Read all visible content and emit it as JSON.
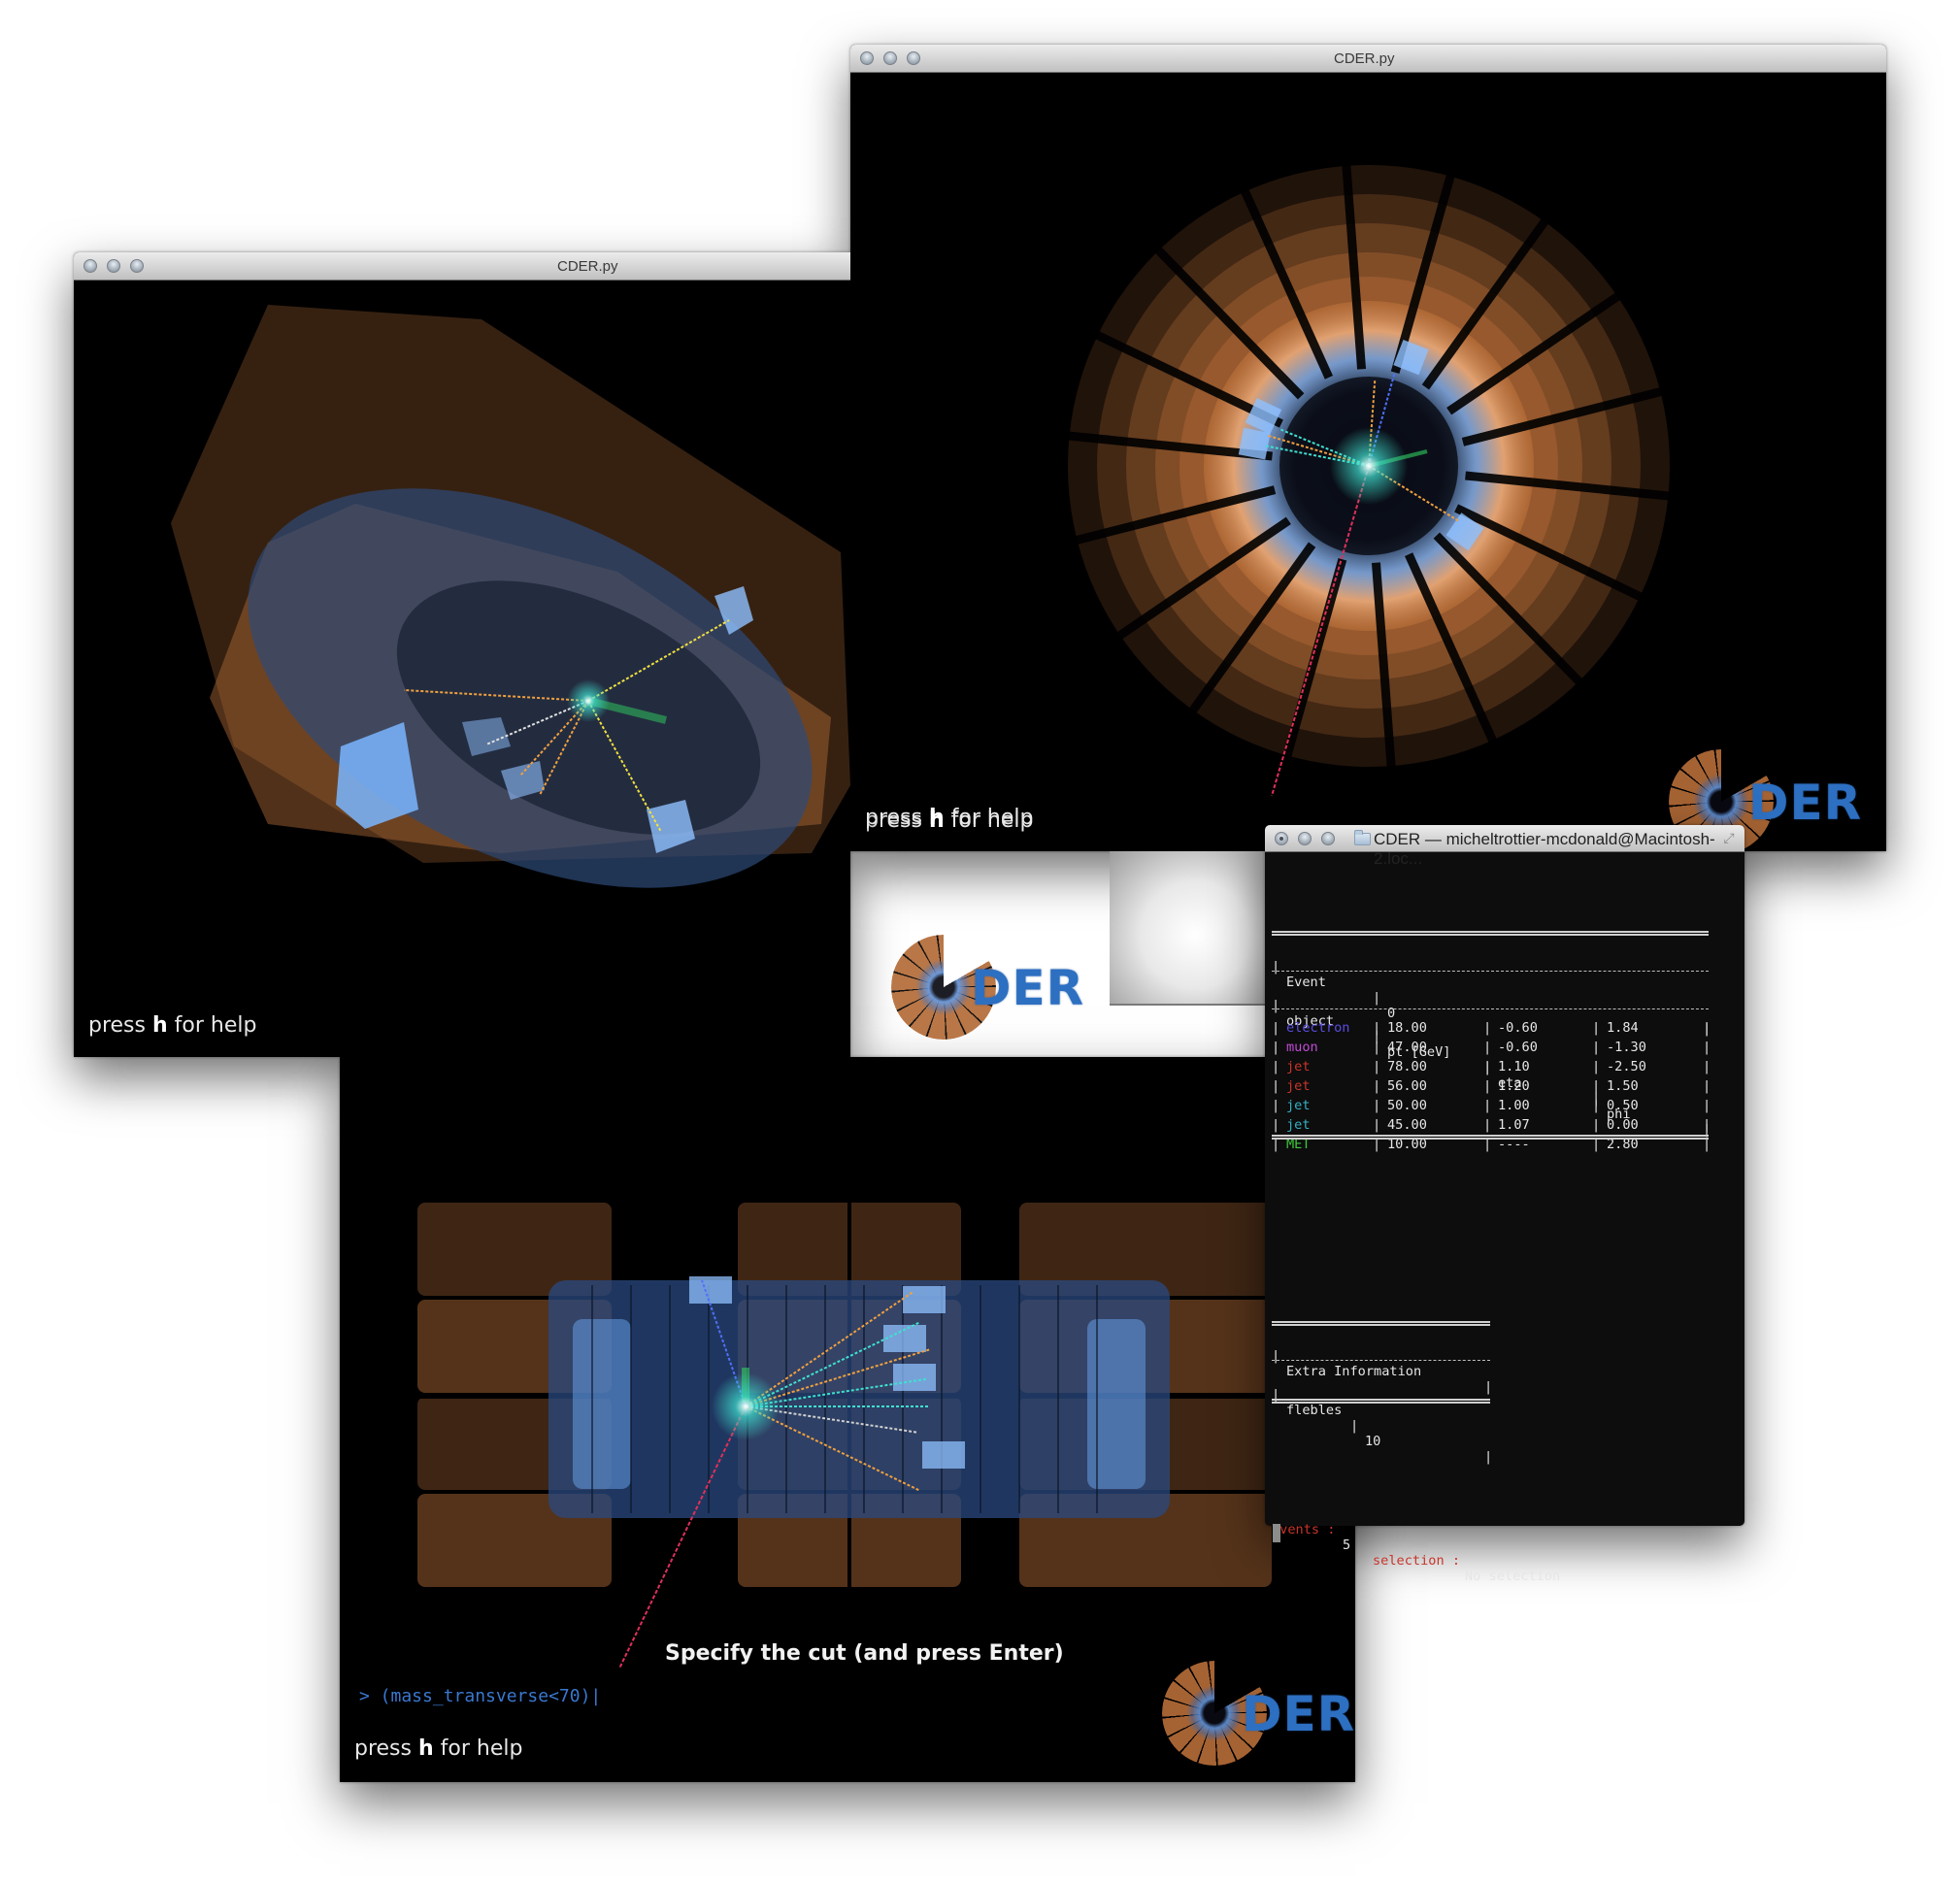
{
  "windows": {
    "top_viewer": {
      "title": "CDER.py",
      "help_prefix": "press ",
      "help_key": "h",
      "help_suffix": " for help",
      "logo_text": "DER",
      "view": "transverse (end-on) view"
    },
    "left_viewer": {
      "title": "CDER.py",
      "help_prefix": "press ",
      "help_key": "h",
      "help_suffix": " for help",
      "logo_text": "DER",
      "view": "perspective view"
    },
    "bottom_viewer": {
      "cut_label": "Specify the cut (and press Enter)",
      "cut_input": "> (mass_transverse<70)|",
      "help_prefix": "press ",
      "help_key": "h",
      "help_suffix": " for help",
      "logo_text": "DER",
      "view": "longitudinal (side) view"
    },
    "terminal": {
      "title": "CDER — micheltrottier-mcdonald@Macintosh-2.loc...",
      "event_label": "Event",
      "event_value": "0",
      "columns": [
        "object",
        "pt [GeV]",
        "eta",
        "phi"
      ],
      "rows": [
        {
          "object": "electron",
          "pt": "18.00",
          "eta": "-0.60",
          "phi": "1.84",
          "color": "#5a4de0"
        },
        {
          "object": "muon",
          "pt": "47.00",
          "eta": "-0.60",
          "phi": "-1.30",
          "color": "#c14bd6"
        },
        {
          "object": "jet",
          "pt": "78.00",
          "eta": "1.10",
          "phi": "-2.50",
          "color": "#c8352b"
        },
        {
          "object": "jet",
          "pt": "56.00",
          "eta": "1.20",
          "phi": "1.50",
          "color": "#c8352b"
        },
        {
          "object": "jet",
          "pt": "50.00",
          "eta": "1.00",
          "phi": "0.50",
          "color": "#35b0c4"
        },
        {
          "object": "jet",
          "pt": "45.00",
          "eta": "1.07",
          "phi": "0.00",
          "color": "#35b0c4"
        },
        {
          "object": "MET",
          "pt": "10.00",
          "eta": "----",
          "phi": "2.80",
          "color": "#3cc83c"
        }
      ],
      "extra_title": "Extra Information",
      "extra_key": "flebles",
      "extra_value": "10",
      "status": {
        "events_label": "Events :",
        "events_value": "5",
        "selection_label": "selection :",
        "selection_value": "No selection"
      }
    }
  },
  "colors": {
    "calorimeter_hadronic": "#b46c38",
    "calorimeter_em": "#6aa6f0",
    "track": "#f0a040",
    "met": "#30d060",
    "muon_track": "#e0305a",
    "logo_blue": "#2d6fc1"
  }
}
